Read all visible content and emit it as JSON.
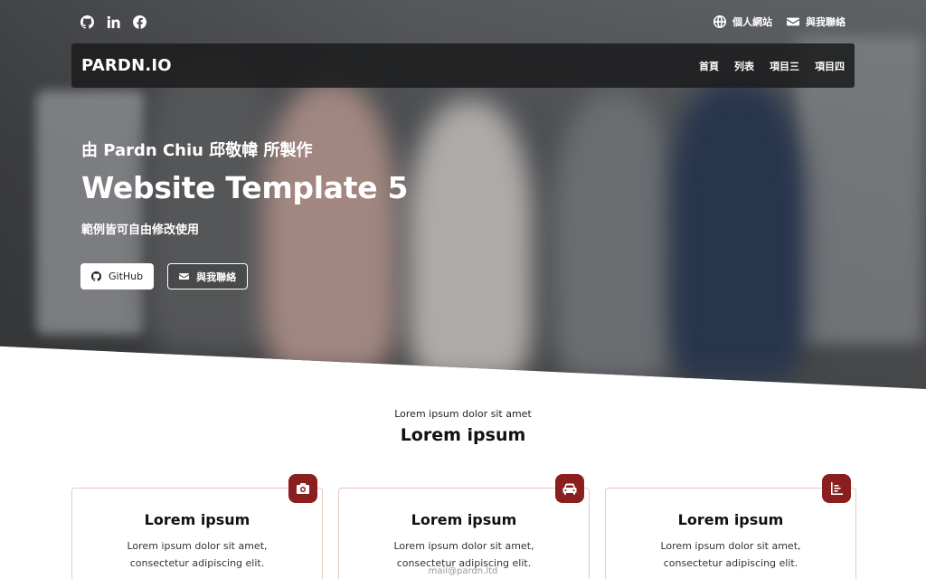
{
  "topbar": {
    "social": [
      "github-icon",
      "linkedin-icon",
      "facebook-icon"
    ],
    "links": [
      {
        "icon": "globe-icon",
        "label": "個人網站"
      },
      {
        "icon": "envelope-icon",
        "label": "與我聯絡"
      }
    ]
  },
  "nav": {
    "brand": "PARDN.IO",
    "items": [
      "首頁",
      "列表",
      "項目三",
      "項目四"
    ]
  },
  "hero": {
    "subtitle": "由 Pardn Chiu 邱敬幃 所製作",
    "title": "Website Template 5",
    "description": "範例皆可自由修改使用",
    "buttons": [
      {
        "icon": "github-icon",
        "label": "GitHub"
      },
      {
        "icon": "envelope-icon",
        "label": "與我聯絡"
      }
    ]
  },
  "section": {
    "kicker": "Lorem ipsum dolor sit amet",
    "title": "Lorem ipsum",
    "cards": [
      {
        "icon": "camera-icon",
        "title": "Lorem ipsum",
        "text": "Lorem ipsum dolor sit amet, consectetur adipiscing elit."
      },
      {
        "icon": "car-icon",
        "title": "Lorem ipsum",
        "text": "Lorem ipsum dolor sit amet, consectetur adipiscing elit."
      },
      {
        "icon": "list-icon",
        "title": "Lorem ipsum",
        "text": "Lorem ipsum dolor sit amet, consectetur adipiscing elit."
      }
    ]
  },
  "footer": {
    "email": "mail@pardn.ltd"
  },
  "colors": {
    "accent": "#8b1e1e",
    "card_border": "#e9c6c0",
    "nav_bg": "#1c1c1e"
  }
}
